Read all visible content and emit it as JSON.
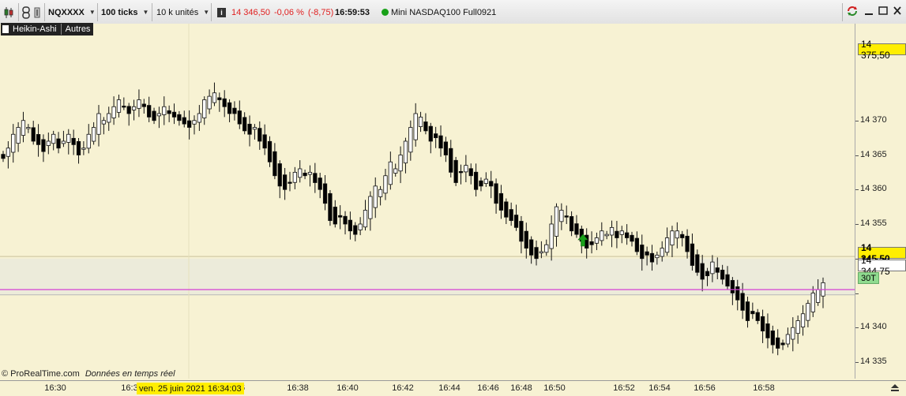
{
  "toolbar": {
    "symbol": "NQXXXX",
    "interval": "100 ticks",
    "units": "10 k unités",
    "last_price": "14 346,50",
    "change_pct": "-0,06 %",
    "change_abs": "(-8,75)",
    "time": "16:59:53",
    "instrument": "Mini NASDAQ100 Full0921",
    "info_icon_label": "i",
    "colors": {
      "down": "#e02020",
      "status_dot": "#19a119"
    }
  },
  "chart_header": {
    "type": "Heikin-Ashi",
    "other": "Autres"
  },
  "chart_data": {
    "type": "candlestick",
    "title": "Heikin-Ashi",
    "ylim": [
      14331.5,
      14380
    ],
    "y_ticks": [
      14335,
      14340,
      14345,
      14350,
      14355,
      14360,
      14365,
      14370
    ],
    "y_tick_labels": [
      "14 335",
      "14 340",
      "",
      "14 350",
      "14 355",
      "14 360",
      "14 365",
      "14 370"
    ],
    "x_tick_labels": [
      "16:30",
      "16:3",
      "6",
      "16:38",
      "16:40",
      "16:42",
      "16:44",
      "16:46",
      "16:48",
      "16:50",
      "16:52",
      "16:54",
      "16:56",
      "16:58"
    ],
    "closes": [
      14364.5,
      14366,
      14368,
      14369,
      14370,
      14369,
      14367,
      14366.5,
      14365.5,
      14367,
      14368,
      14366,
      14367,
      14368,
      14366.5,
      14365,
      14366,
      14368,
      14369,
      14371,
      14370,
      14371,
      14372,
      14373,
      14372,
      14371,
      14372,
      14373,
      14372,
      14370.5,
      14370,
      14371,
      14372,
      14371,
      14370.5,
      14370,
      14369.5,
      14369,
      14370,
      14371,
      14373,
      14373.5,
      14374,
      14373,
      14372,
      14371,
      14371,
      14369.5,
      14368.5,
      14368,
      14369,
      14367,
      14366,
      14364,
      14362,
      14360.5,
      14360,
      14361,
      14362.5,
      14363,
      14362,
      14362.5,
      14361,
      14360,
      14358,
      14355.5,
      14355,
      14356,
      14355,
      14354,
      14353.5,
      14355,
      14357,
      14359,
      14360.5,
      14360,
      14362,
      14364,
      14363,
      14365,
      14367,
      14369,
      14371,
      14370.5,
      14368.5,
      14367,
      14367.5,
      14366,
      14365,
      14362.5,
      14361,
      14362.5,
      14363.5,
      14362,
      14360,
      14360.5,
      14361.5,
      14360.5,
      14358,
      14357,
      14356,
      14355.5,
      14354.5,
      14352.5,
      14351.5,
      14350.5,
      14350,
      14351,
      14352,
      14355,
      14357.5,
      14357,
      14356,
      14354,
      14353.5,
      14352.5,
      14351.5,
      14352,
      14353,
      14354,
      14353.5,
      14354.5,
      14353,
      14354,
      14353,
      14352.5,
      14351,
      14350,
      14350.5,
      14349.5,
      14350.5,
      14351.5,
      14353,
      14354,
      14354,
      14353,
      14351,
      14349,
      14348,
      14347,
      14347.5,
      14349.5,
      14348,
      14347,
      14346,
      14345,
      14344,
      14342.5,
      14341,
      14342,
      14341,
      14339.5,
      14338.5,
      14337.5,
      14337,
      14337.5,
      14339,
      14340,
      14341,
      14342,
      14343.5,
      14345,
      14345.5,
      14346.5
    ],
    "last_price": "14 345,50",
    "reference_price": "14 344,75",
    "top_price": "14 375,50",
    "level_label": "14 350",
    "tag_30t": "30T",
    "crosshair_date": "ven. 25 juin 2021 16:34:03",
    "colors": {
      "bull": "#ffffff",
      "bear": "#000000",
      "background": "#f7f2d3",
      "last_line": "#d43fd4",
      "band": "#ecebda",
      "arrow": "#1aa11a",
      "tag_yellow": "#ffee00",
      "tag_green": "#8fdb8f"
    }
  },
  "footer": {
    "copyright": "© ProRealTime.com",
    "realtime": "Données en temps réel"
  }
}
